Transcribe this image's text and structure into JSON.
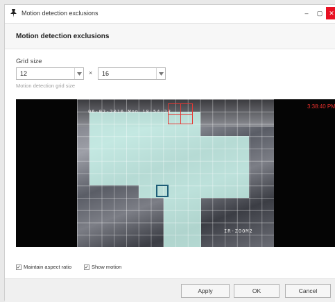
{
  "window": {
    "title": "Motion detection exclusions",
    "controls": {
      "minimize": "–",
      "maximize": "▢",
      "close": "✕"
    },
    "app_icon": "pushpin-icon"
  },
  "header": {
    "title": "Motion detection exclusions"
  },
  "grid_size": {
    "label": "Grid size",
    "columns_value": "12",
    "rows_value": "16",
    "times_symbol": "×",
    "hint": "Motion detection grid size"
  },
  "video": {
    "timestamp_osd": "06-02-2016 Mon 10:54:23",
    "camera_label_osd": "IR-ZOOM2",
    "clock": "3:38:40 PM"
  },
  "options": {
    "maintain_aspect_ratio": {
      "label": "Maintain aspect ratio",
      "checked": true
    },
    "show_motion": {
      "label": "Show motion",
      "checked": true
    }
  },
  "buttons": {
    "apply": "Apply",
    "ok": "OK",
    "cancel": "Cancel"
  },
  "colors": {
    "overlay": "#cdfaf0",
    "selection_red": "#e53935",
    "selection_blue": "#1e5e78",
    "close_button": "#e81123"
  }
}
